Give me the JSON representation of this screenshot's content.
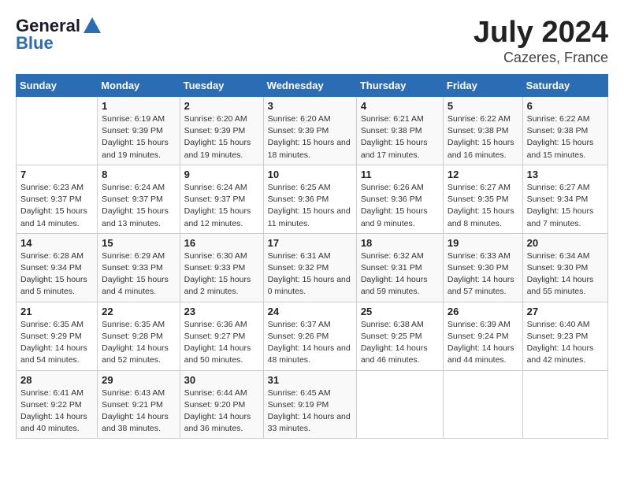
{
  "header": {
    "logo_line1": "General",
    "logo_line2": "Blue",
    "month_year": "July 2024",
    "location": "Cazeres, France"
  },
  "days_of_week": [
    "Sunday",
    "Monday",
    "Tuesday",
    "Wednesday",
    "Thursday",
    "Friday",
    "Saturday"
  ],
  "weeks": [
    [
      {
        "day": "",
        "sunrise": "",
        "sunset": "",
        "daylight": ""
      },
      {
        "day": "1",
        "sunrise": "Sunrise: 6:19 AM",
        "sunset": "Sunset: 9:39 PM",
        "daylight": "Daylight: 15 hours and 19 minutes."
      },
      {
        "day": "2",
        "sunrise": "Sunrise: 6:20 AM",
        "sunset": "Sunset: 9:39 PM",
        "daylight": "Daylight: 15 hours and 19 minutes."
      },
      {
        "day": "3",
        "sunrise": "Sunrise: 6:20 AM",
        "sunset": "Sunset: 9:39 PM",
        "daylight": "Daylight: 15 hours and 18 minutes."
      },
      {
        "day": "4",
        "sunrise": "Sunrise: 6:21 AM",
        "sunset": "Sunset: 9:38 PM",
        "daylight": "Daylight: 15 hours and 17 minutes."
      },
      {
        "day": "5",
        "sunrise": "Sunrise: 6:22 AM",
        "sunset": "Sunset: 9:38 PM",
        "daylight": "Daylight: 15 hours and 16 minutes."
      },
      {
        "day": "6",
        "sunrise": "Sunrise: 6:22 AM",
        "sunset": "Sunset: 9:38 PM",
        "daylight": "Daylight: 15 hours and 15 minutes."
      }
    ],
    [
      {
        "day": "7",
        "sunrise": "Sunrise: 6:23 AM",
        "sunset": "Sunset: 9:37 PM",
        "daylight": "Daylight: 15 hours and 14 minutes."
      },
      {
        "day": "8",
        "sunrise": "Sunrise: 6:24 AM",
        "sunset": "Sunset: 9:37 PM",
        "daylight": "Daylight: 15 hours and 13 minutes."
      },
      {
        "day": "9",
        "sunrise": "Sunrise: 6:24 AM",
        "sunset": "Sunset: 9:37 PM",
        "daylight": "Daylight: 15 hours and 12 minutes."
      },
      {
        "day": "10",
        "sunrise": "Sunrise: 6:25 AM",
        "sunset": "Sunset: 9:36 PM",
        "daylight": "Daylight: 15 hours and 11 minutes."
      },
      {
        "day": "11",
        "sunrise": "Sunrise: 6:26 AM",
        "sunset": "Sunset: 9:36 PM",
        "daylight": "Daylight: 15 hours and 9 minutes."
      },
      {
        "day": "12",
        "sunrise": "Sunrise: 6:27 AM",
        "sunset": "Sunset: 9:35 PM",
        "daylight": "Daylight: 15 hours and 8 minutes."
      },
      {
        "day": "13",
        "sunrise": "Sunrise: 6:27 AM",
        "sunset": "Sunset: 9:34 PM",
        "daylight": "Daylight: 15 hours and 7 minutes."
      }
    ],
    [
      {
        "day": "14",
        "sunrise": "Sunrise: 6:28 AM",
        "sunset": "Sunset: 9:34 PM",
        "daylight": "Daylight: 15 hours and 5 minutes."
      },
      {
        "day": "15",
        "sunrise": "Sunrise: 6:29 AM",
        "sunset": "Sunset: 9:33 PM",
        "daylight": "Daylight: 15 hours and 4 minutes."
      },
      {
        "day": "16",
        "sunrise": "Sunrise: 6:30 AM",
        "sunset": "Sunset: 9:33 PM",
        "daylight": "Daylight: 15 hours and 2 minutes."
      },
      {
        "day": "17",
        "sunrise": "Sunrise: 6:31 AM",
        "sunset": "Sunset: 9:32 PM",
        "daylight": "Daylight: 15 hours and 0 minutes."
      },
      {
        "day": "18",
        "sunrise": "Sunrise: 6:32 AM",
        "sunset": "Sunset: 9:31 PM",
        "daylight": "Daylight: 14 hours and 59 minutes."
      },
      {
        "day": "19",
        "sunrise": "Sunrise: 6:33 AM",
        "sunset": "Sunset: 9:30 PM",
        "daylight": "Daylight: 14 hours and 57 minutes."
      },
      {
        "day": "20",
        "sunrise": "Sunrise: 6:34 AM",
        "sunset": "Sunset: 9:30 PM",
        "daylight": "Daylight: 14 hours and 55 minutes."
      }
    ],
    [
      {
        "day": "21",
        "sunrise": "Sunrise: 6:35 AM",
        "sunset": "Sunset: 9:29 PM",
        "daylight": "Daylight: 14 hours and 54 minutes."
      },
      {
        "day": "22",
        "sunrise": "Sunrise: 6:35 AM",
        "sunset": "Sunset: 9:28 PM",
        "daylight": "Daylight: 14 hours and 52 minutes."
      },
      {
        "day": "23",
        "sunrise": "Sunrise: 6:36 AM",
        "sunset": "Sunset: 9:27 PM",
        "daylight": "Daylight: 14 hours and 50 minutes."
      },
      {
        "day": "24",
        "sunrise": "Sunrise: 6:37 AM",
        "sunset": "Sunset: 9:26 PM",
        "daylight": "Daylight: 14 hours and 48 minutes."
      },
      {
        "day": "25",
        "sunrise": "Sunrise: 6:38 AM",
        "sunset": "Sunset: 9:25 PM",
        "daylight": "Daylight: 14 hours and 46 minutes."
      },
      {
        "day": "26",
        "sunrise": "Sunrise: 6:39 AM",
        "sunset": "Sunset: 9:24 PM",
        "daylight": "Daylight: 14 hours and 44 minutes."
      },
      {
        "day": "27",
        "sunrise": "Sunrise: 6:40 AM",
        "sunset": "Sunset: 9:23 PM",
        "daylight": "Daylight: 14 hours and 42 minutes."
      }
    ],
    [
      {
        "day": "28",
        "sunrise": "Sunrise: 6:41 AM",
        "sunset": "Sunset: 9:22 PM",
        "daylight": "Daylight: 14 hours and 40 minutes."
      },
      {
        "day": "29",
        "sunrise": "Sunrise: 6:43 AM",
        "sunset": "Sunset: 9:21 PM",
        "daylight": "Daylight: 14 hours and 38 minutes."
      },
      {
        "day": "30",
        "sunrise": "Sunrise: 6:44 AM",
        "sunset": "Sunset: 9:20 PM",
        "daylight": "Daylight: 14 hours and 36 minutes."
      },
      {
        "day": "31",
        "sunrise": "Sunrise: 6:45 AM",
        "sunset": "Sunset: 9:19 PM",
        "daylight": "Daylight: 14 hours and 33 minutes."
      },
      {
        "day": "",
        "sunrise": "",
        "sunset": "",
        "daylight": ""
      },
      {
        "day": "",
        "sunrise": "",
        "sunset": "",
        "daylight": ""
      },
      {
        "day": "",
        "sunrise": "",
        "sunset": "",
        "daylight": ""
      }
    ]
  ]
}
